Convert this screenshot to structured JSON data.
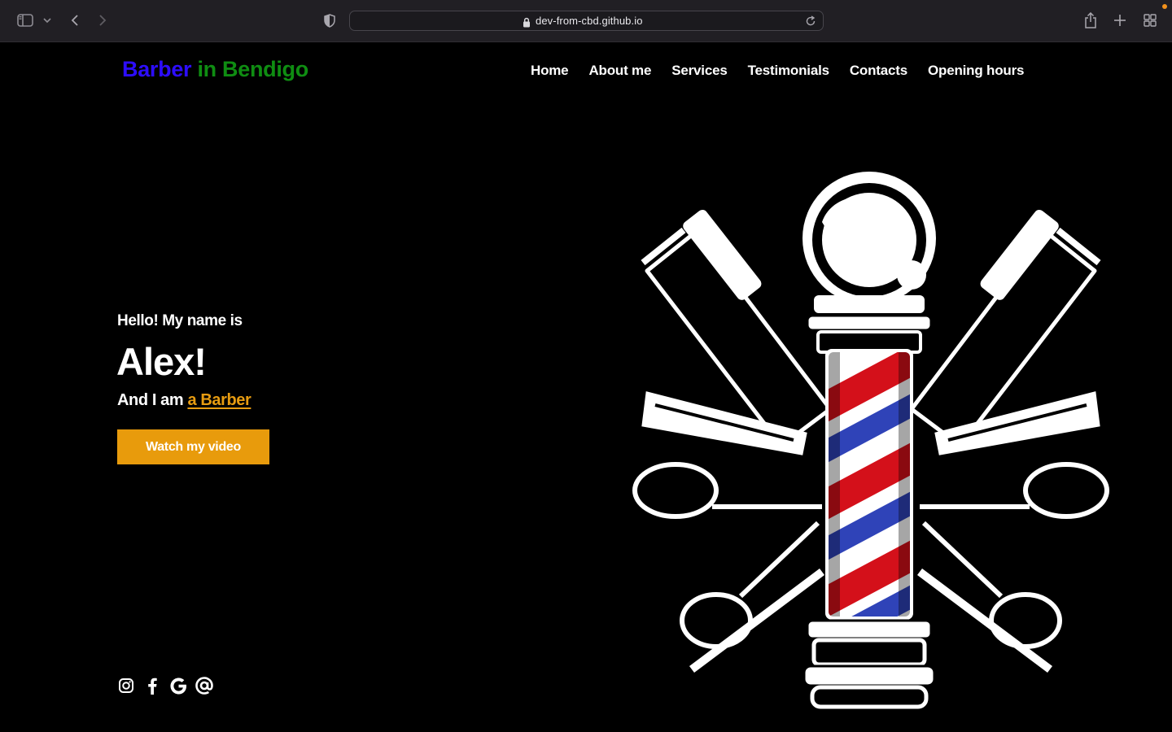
{
  "browser": {
    "url": "dev-from-cbd.github.io",
    "icons": [
      "sidebar-toggle-icon",
      "chevron-down-icon",
      "back-arrow-icon",
      "forward-arrow-icon",
      "privacy-shield-icon",
      "lock-icon",
      "reload-icon",
      "share-icon",
      "new-tab-icon",
      "tab-overview-icon"
    ]
  },
  "header": {
    "logo_part1": "Barber",
    "logo_part2": "in Bendigo",
    "nav": [
      "Home",
      "About me",
      "Services",
      "Testimonials",
      "Contacts",
      "Opening hours"
    ]
  },
  "hero": {
    "greeting": "Hello! My name is",
    "name": "Alex!",
    "intro_prefix": "And I am",
    "intro_role": "a Barber",
    "cta_label": "Watch my video"
  },
  "social_icons": [
    "instagram-icon",
    "facebook-icon",
    "google-icon",
    "email-at-icon"
  ],
  "colors": {
    "logo_blue": "#2d0dff",
    "logo_green": "#0f8d12",
    "accent_orange": "#e89b0c",
    "pole_red": "#d4101a",
    "pole_blue": "#2f43b8",
    "background": "#000000"
  }
}
